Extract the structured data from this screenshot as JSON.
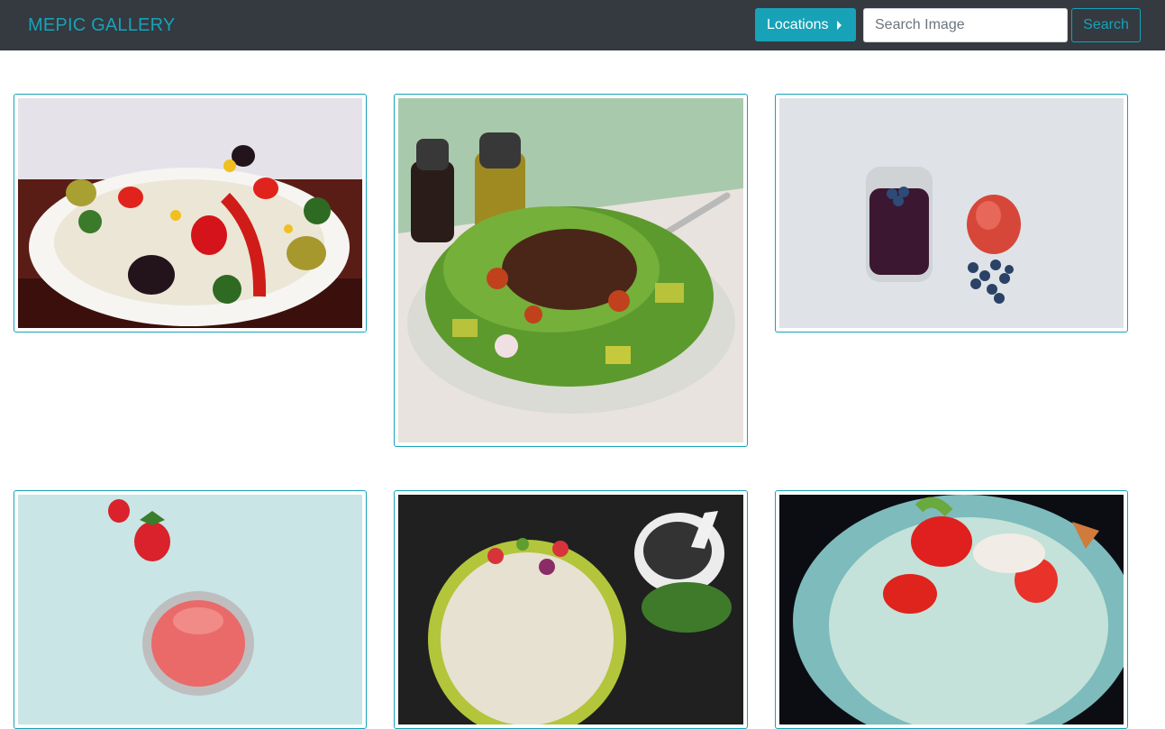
{
  "navbar": {
    "brand": "MEPIC GALLERY",
    "locations_label": "Locations",
    "search": {
      "placeholder": "Search Image",
      "value": ""
    },
    "search_button_label": "Search"
  },
  "gallery": {
    "images": [
      {
        "subject": "salad-plate-with-olives-and-peppers"
      },
      {
        "subject": "green-salad-with-pecans-and-oil-bottles"
      },
      {
        "subject": "berry-smoothie-with-apple-and-blueberries"
      },
      {
        "subject": "strawberry-smoothie"
      },
      {
        "subject": "salad-bowl-with-mortar-and-pestle"
      },
      {
        "subject": "salad-bowl-with-tomatoes"
      }
    ]
  },
  "colors": {
    "navbar_bg": "#343a40",
    "accent": "#17a2b8"
  }
}
